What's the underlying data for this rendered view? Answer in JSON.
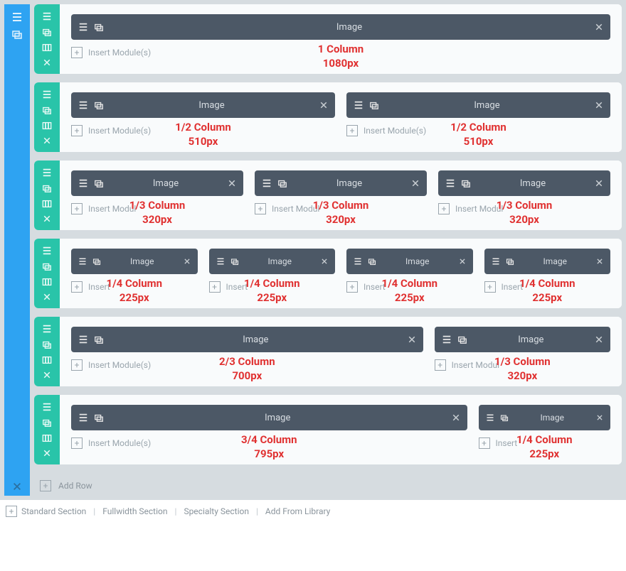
{
  "colors": {
    "section_accent": "#2ea3f2",
    "row_accent": "#29c4a9",
    "module_bg": "#4c5866",
    "annotation": "#e03131"
  },
  "labels": {
    "module_title": "Image",
    "insert_module": "Insert Module(s)",
    "insert_module_short": "Insert Modul",
    "insert_module_med": "Insert Modul",
    "insert_tiny": "Insert",
    "add_row": "Add Row"
  },
  "footer": {
    "standard": "Standard Section",
    "fullwidth": "Fullwidth Section",
    "specialty": "Specialty Section",
    "library": "Add From Library"
  },
  "rows": [
    {
      "columns": [
        {
          "label_line1": "1 Column",
          "label_line2": "1080px",
          "insert_key": "insert_module"
        }
      ]
    },
    {
      "columns": [
        {
          "label_line1": "1/2 Column",
          "label_line2": "510px",
          "insert_key": "insert_module"
        },
        {
          "label_line1": "1/2 Column",
          "label_line2": "510px",
          "insert_key": "insert_module"
        }
      ]
    },
    {
      "columns": [
        {
          "label_line1": "1/3 Column",
          "label_line2": "320px",
          "insert_key": "insert_module_short"
        },
        {
          "label_line1": "1/3 Column",
          "label_line2": "320px",
          "insert_key": "insert_module_short"
        },
        {
          "label_line1": "1/3 Column",
          "label_line2": "320px",
          "insert_key": "insert_module_short"
        }
      ]
    },
    {
      "columns": [
        {
          "label_line1": "1/4 Column",
          "label_line2": "225px",
          "insert_key": "insert_tiny"
        },
        {
          "label_line1": "1/4 Column",
          "label_line2": "225px",
          "insert_key": "insert_tiny"
        },
        {
          "label_line1": "1/4 Column",
          "label_line2": "225px",
          "insert_key": "insert_tiny"
        },
        {
          "label_line1": "1/4 Column",
          "label_line2": "225px",
          "insert_key": "insert_tiny"
        }
      ]
    },
    {
      "columns": [
        {
          "label_line1": "2/3 Column",
          "label_line2": "700px",
          "insert_key": "insert_module",
          "span": "two-third"
        },
        {
          "label_line1": "1/3 Column",
          "label_line2": "320px",
          "insert_key": "insert_module_med",
          "span": "one-third-in-mix"
        }
      ]
    },
    {
      "columns": [
        {
          "label_line1": "3/4 Column",
          "label_line2": "795px",
          "insert_key": "insert_module",
          "span": "three-quarter"
        },
        {
          "label_line1": "1/4 Column",
          "label_line2": "225px",
          "insert_key": "insert_tiny",
          "span": "one-quarter-in-mix"
        }
      ]
    }
  ]
}
